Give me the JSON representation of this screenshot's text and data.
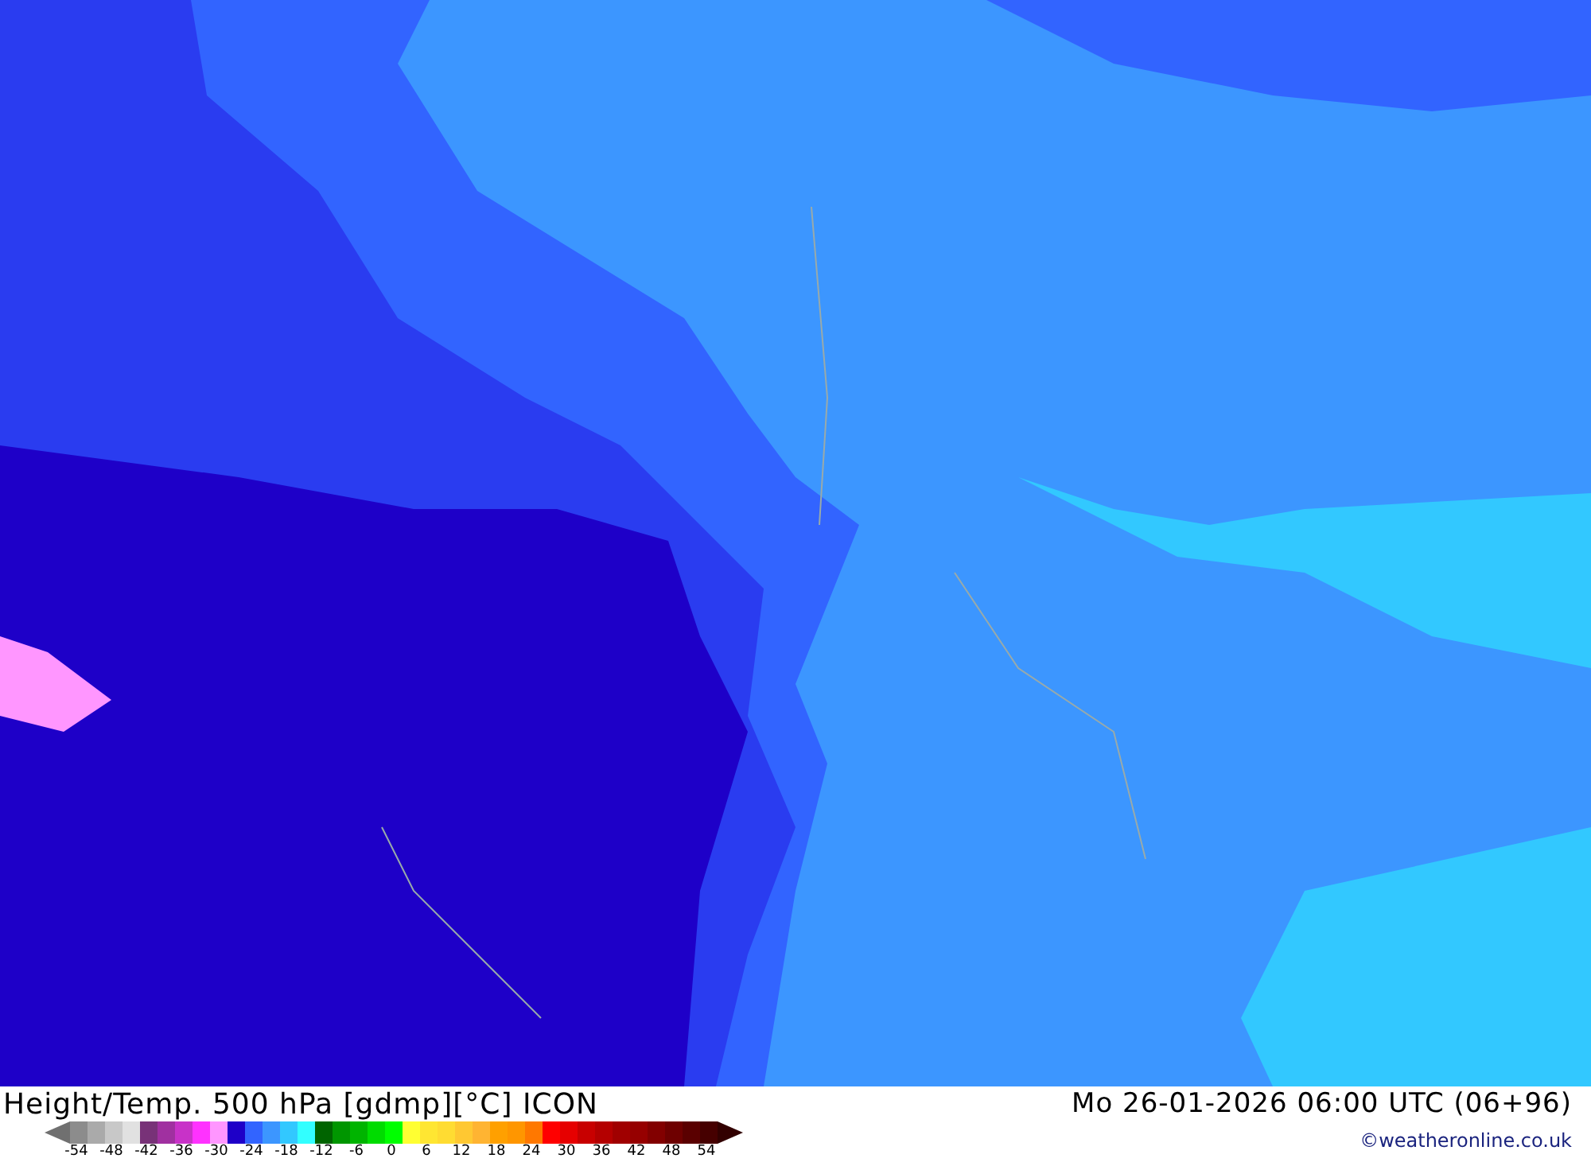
{
  "title": "Height/Temp. 500 hPa [gdmp][°C] ICON",
  "valid_time": "Mo 26-01-2026 06:00 UTC (06+96)",
  "legend": {
    "swatches": [
      {
        "color": "#8c8c8c"
      },
      {
        "color": "#aaaaaa"
      },
      {
        "color": "#c8c8c8"
      },
      {
        "color": "#e1e1e1"
      },
      {
        "color": "#783278"
      },
      {
        "color": "#a030a0"
      },
      {
        "color": "#c832c8"
      },
      {
        "color": "#ff32ff"
      },
      {
        "color": "#ff96ff"
      },
      {
        "color": "#1e00c8"
      },
      {
        "color": "#3264ff"
      },
      {
        "color": "#3c96ff"
      },
      {
        "color": "#32c8ff"
      },
      {
        "color": "#32ffff"
      },
      {
        "color": "#006400"
      },
      {
        "color": "#009600"
      },
      {
        "color": "#00b400"
      },
      {
        "color": "#00dc00"
      },
      {
        "color": "#00ff00"
      },
      {
        "color": "#ffff32"
      },
      {
        "color": "#ffe632"
      },
      {
        "color": "#ffdc32"
      },
      {
        "color": "#ffc832"
      },
      {
        "color": "#ffb432"
      },
      {
        "color": "#ffa000"
      },
      {
        "color": "#ff9600"
      },
      {
        "color": "#ff7800"
      },
      {
        "color": "#ff0000"
      },
      {
        "color": "#e60000"
      },
      {
        "color": "#c80000"
      },
      {
        "color": "#b40000"
      },
      {
        "color": "#a00000"
      },
      {
        "color": "#960000"
      },
      {
        "color": "#820000"
      },
      {
        "color": "#6e0000"
      },
      {
        "color": "#5a0000"
      },
      {
        "color": "#460000"
      }
    ],
    "ticks": [
      "-54",
      "-48",
      "-42",
      "-36",
      "-30",
      "-24",
      "-18",
      "-12",
      "-6",
      "0",
      "6",
      "12",
      "18",
      "24",
      "30",
      "36",
      "42",
      "48",
      "54"
    ]
  },
  "copyright": "©weatheronline.co.uk"
}
